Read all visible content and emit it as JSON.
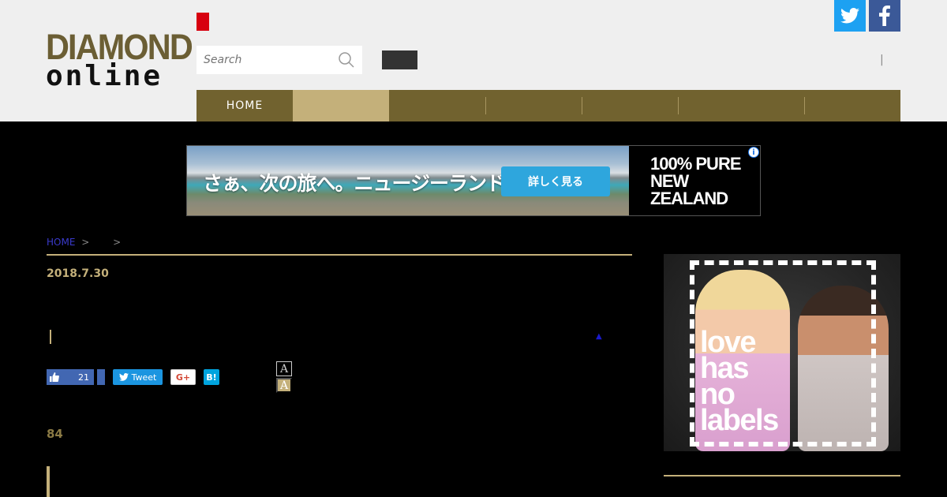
{
  "logo": {
    "line1": "DIAMOND",
    "line2": "online"
  },
  "search": {
    "placeholder": "Search"
  },
  "nav": {
    "items": [
      {
        "label": "HOME",
        "active": false
      },
      {
        "label": "",
        "active": true
      },
      {
        "label": "",
        "active": false
      },
      {
        "label": "",
        "active": false
      },
      {
        "label": "",
        "active": false
      },
      {
        "label": "",
        "active": false
      },
      {
        "label": "",
        "active": false
      }
    ]
  },
  "banner_ad": {
    "headline": "さぁ、次の旅へ。ニュージーランド",
    "cta": "詳しく見る",
    "brand_line1": "100% PURE",
    "brand_line2": "NEW ZEALAND",
    "info": "i"
  },
  "breadcrumb": {
    "home": "HOME",
    "sep1": ">",
    "sep2": ">"
  },
  "article": {
    "date": "2018.7.30",
    "count": "84"
  },
  "share": {
    "like_count": "21",
    "tweet": "Tweet",
    "gplus": "G+",
    "hatena": "B!"
  },
  "font_size": {
    "a_small": "A",
    "a_large": "A"
  },
  "side_ad": {
    "line1": "love",
    "line2": "has",
    "line3": "no",
    "line4": "labels"
  },
  "colors": {
    "gold": "#c4b07a",
    "nav_bg": "#71622f",
    "header_bg": "#efefef",
    "twitter": "#1da1f2",
    "facebook": "#3b5998"
  },
  "icons": {
    "search": "search-icon",
    "twitter": "twitter-icon",
    "facebook": "facebook-icon",
    "like": "thumbs-up-icon",
    "tweet": "twitter-bird-icon",
    "triangle": "triangle-up-icon"
  }
}
